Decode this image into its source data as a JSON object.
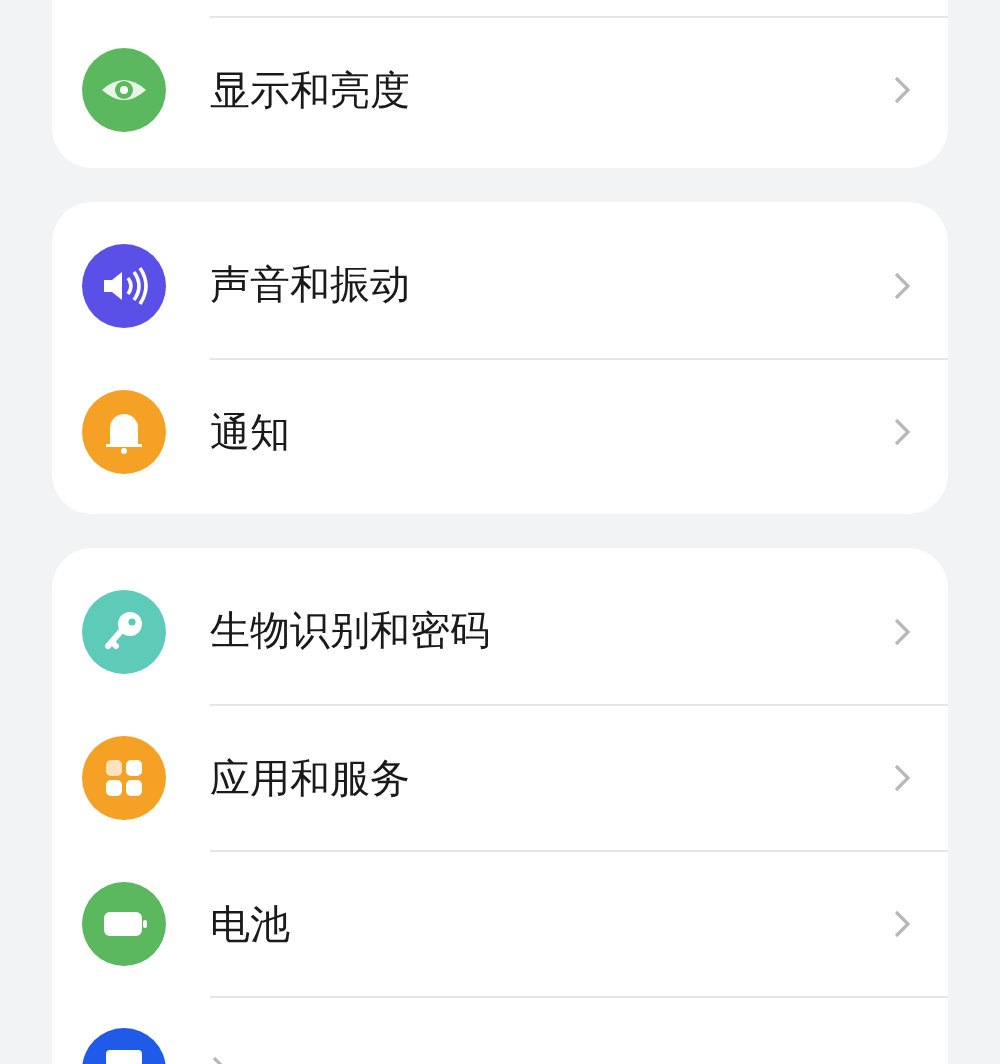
{
  "groups": [
    {
      "items": [
        {
          "label": "显示和亮度",
          "color": "#5cb85f"
        }
      ]
    },
    {
      "items": [
        {
          "label": "声音和振动",
          "color": "#5a4fe6"
        },
        {
          "label": "通知",
          "color": "#f5a125"
        }
      ]
    },
    {
      "items": [
        {
          "label": "生物识别和密码",
          "color": "#5ecab8"
        },
        {
          "label": "应用和服务",
          "color": "#f5a125"
        },
        {
          "label": "电池",
          "color": "#5cb85f"
        },
        {
          "color": "#1f5be8"
        }
      ]
    }
  ]
}
